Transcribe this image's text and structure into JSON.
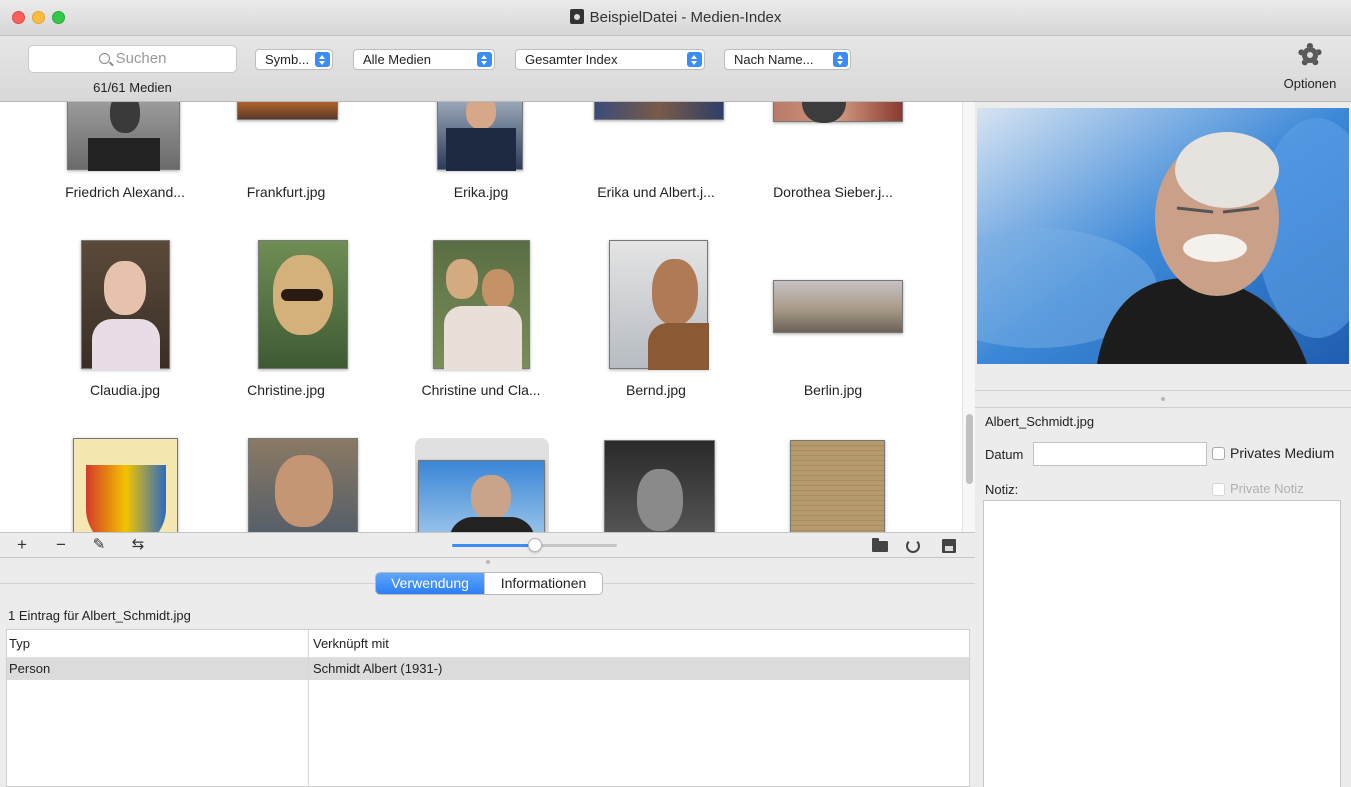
{
  "window": {
    "title": "BeispielDatei - Medien-Index"
  },
  "toolbar": {
    "search_placeholder": "Suchen",
    "media_count": "61/61 Medien",
    "view_popup": "Symb...",
    "media_filter_popup": "Alle Medien",
    "index_popup": "Gesamter Index",
    "sort_popup": "Nach Name...",
    "options_label": "Optionen"
  },
  "grid": {
    "row1": [
      "Friedrich Alexand...",
      "Frankfurt.jpg",
      "Erika.jpg",
      "Erika und Albert.j...",
      "Dorothea Sieber.j..."
    ],
    "row2": [
      "Claudia.jpg",
      "Christine.jpg",
      "Christine und Cla...",
      "Bernd.jpg",
      "Berlin.jpg"
    ],
    "thumbnail_size": 0.5
  },
  "gridbar": {
    "add": "+",
    "remove": "−",
    "edit": "✎",
    "merge": "⇆"
  },
  "bottom": {
    "tabs": [
      "Verwendung",
      "Informationen"
    ],
    "active_tab": "Verwendung",
    "entry_info": "1 Eintrag für Albert_Schmidt.jpg",
    "columns": [
      "Typ",
      "Verknüpft mit"
    ],
    "rows": [
      {
        "type": "Person",
        "linked": "Schmidt Albert (1931-)"
      }
    ]
  },
  "detail": {
    "filename": "Albert_Schmidt.jpg",
    "datum_label": "Datum",
    "datum_value": "",
    "private_medium_label": "Privates Medium",
    "notiz_label": "Notiz:",
    "private_notiz_label": "Private Notiz"
  },
  "colors": {
    "accent": "#3b8cf6",
    "selection": "#dcdcdc"
  }
}
